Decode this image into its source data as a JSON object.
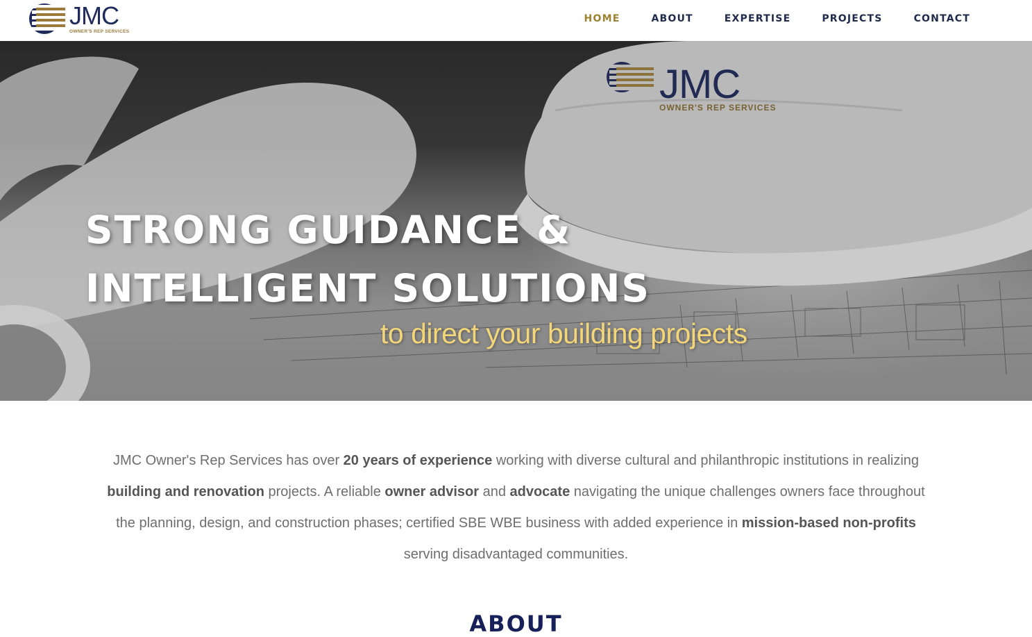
{
  "header": {
    "logo": {
      "word": "JMC",
      "sub": "OWNER'S REP SERVICES"
    },
    "nav": [
      {
        "label": "HOME",
        "active": true
      },
      {
        "label": "ABOUT",
        "active": false
      },
      {
        "label": "EXPERTISE",
        "active": false
      },
      {
        "label": "PROJECTS",
        "active": false
      },
      {
        "label": "CONTACT",
        "active": false
      }
    ]
  },
  "hero": {
    "title_line1": "STRONG GUIDANCE &",
    "title_line2": "INTELLIGENT SOLUTIONS",
    "subtitle": "to direct your building projects",
    "helmet_logo": {
      "word": "JMC",
      "sub": "OWNER'S REP SERVICES"
    }
  },
  "intro": {
    "p1": "JMC Owner's Rep Services has over ",
    "b1": "20 years of experience",
    "p2": " working with diverse cultural and philanthropic institutions in realizing ",
    "b2": "building and renovation",
    "p3": " projects. A reliable ",
    "b3": "owner advisor",
    "p4": " and ",
    "b4": "advocate",
    "p5": " navigating the unique challenges owners face throughout the planning, design, and construction phases; certified SBE WBE business with added experience in ",
    "b5": "mission-based non-profits",
    "p6": " serving disadvantaged communities."
  },
  "about": {
    "heading": "ABOUT"
  },
  "colors": {
    "navy": "#1f2b5c",
    "gold": "#9a8230",
    "subtitle_gold": "#f3d67a"
  }
}
